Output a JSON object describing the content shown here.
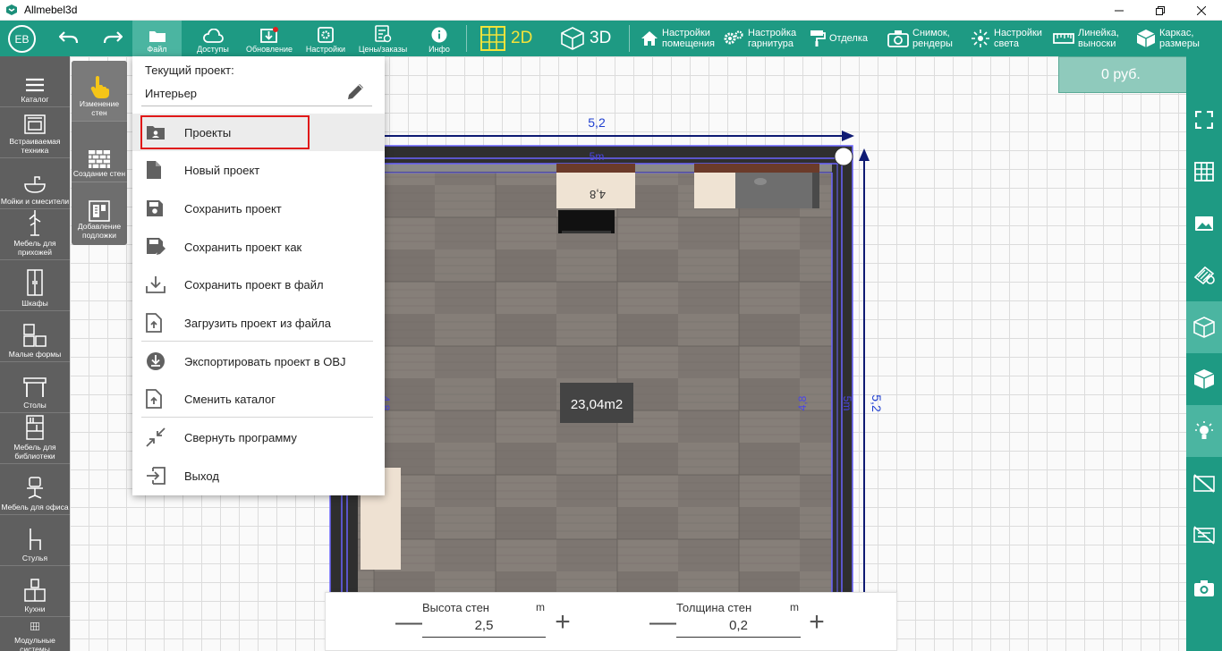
{
  "window": {
    "title": "Allmebel3d",
    "controls": [
      "minimize",
      "restore",
      "close"
    ]
  },
  "toolbar": {
    "avatar": "EB",
    "buttons": [
      {
        "id": "file",
        "label": "Файл",
        "icon": "folder-icon",
        "active": true
      },
      {
        "id": "access",
        "label": "Доступы",
        "icon": "cloud-icon"
      },
      {
        "id": "update",
        "label": "Обновление",
        "icon": "download-icon",
        "badge": true
      },
      {
        "id": "settings",
        "label": "Настройки",
        "icon": "gear-icon"
      },
      {
        "id": "prices",
        "label": "Цены/заказы",
        "icon": "price-list-icon"
      },
      {
        "id": "info",
        "label": "Инфо",
        "icon": "info-icon"
      }
    ],
    "mode_2d": "2D",
    "mode_3d": "3D",
    "tools": [
      {
        "id": "room_settings",
        "label1": "Настройки",
        "label2": "помещения",
        "icon": "home-icon"
      },
      {
        "id": "set_settings",
        "label1": "Настройка",
        "label2": "гарнитура",
        "icon": "gears-icon"
      },
      {
        "id": "finish",
        "label1": "Отделка",
        "label2": "",
        "icon": "paint-roller-icon"
      },
      {
        "id": "snapshot",
        "label1": "Снимок,",
        "label2": "рендеры",
        "icon": "camera-icon"
      },
      {
        "id": "light",
        "label1": "Настройки",
        "label2": "света",
        "icon": "light-icon"
      },
      {
        "id": "ruler",
        "label1": "Линейка,",
        "label2": "выноски",
        "icon": "ruler-icon"
      },
      {
        "id": "frame",
        "label1": "Каркас,",
        "label2": "размеры",
        "icon": "box-icon"
      }
    ]
  },
  "sidebar": {
    "categories": [
      {
        "label": "Каталог",
        "icon": "menu-icon"
      },
      {
        "label": "Встраиваемая техника",
        "icon": "oven-icon"
      },
      {
        "label": "Мойки и смесители",
        "icon": "sink-icon"
      },
      {
        "label": "Мебель для прихожей",
        "icon": "hanger-icon"
      },
      {
        "label": "Шкафы",
        "icon": "wardrobe-icon"
      },
      {
        "label": "Малые формы",
        "icon": "cabinet-icon"
      },
      {
        "label": "Столы",
        "icon": "table-icon"
      },
      {
        "label": "Мебель для библиотеки",
        "icon": "bookshelf-icon"
      },
      {
        "label": "Мебель для офиса",
        "icon": "office-chair-icon"
      },
      {
        "label": "Стулья",
        "icon": "chair-icon"
      },
      {
        "label": "Кухни",
        "icon": "kitchen-icon"
      },
      {
        "label": "Модульные системы",
        "icon": "modules-icon"
      }
    ],
    "tools": [
      {
        "label": "Изменение стен",
        "icon": "hand-pointer-icon",
        "active": true
      },
      {
        "label": "Создание стен",
        "icon": "brick-wall-icon"
      },
      {
        "label": "Добавление подложки",
        "icon": "underlay-icon"
      }
    ]
  },
  "price": {
    "value": "0 руб.",
    "icon": "cart-icon"
  },
  "menu": {
    "current_project_label": "Текущий проект:",
    "project_name": "Интерьер",
    "items": [
      {
        "label": "Проекты",
        "icon": "projects-folder-icon"
      },
      {
        "label": "Новый проект",
        "icon": "new-file-icon"
      },
      {
        "label": "Сохранить проект",
        "icon": "save-icon"
      },
      {
        "label": "Сохранить проект как",
        "icon": "save-as-icon"
      },
      {
        "label": "Сохранить проект в файл",
        "icon": "download-to-file-icon"
      },
      {
        "label": "Загрузить проект из файла",
        "icon": "upload-file-icon"
      },
      {
        "label": "Экспортировать проект в OBJ",
        "icon": "export-icon"
      },
      {
        "label": "Сменить каталог",
        "icon": "change-catalog-icon"
      },
      {
        "label": "Свернуть программу",
        "icon": "minimize-app-icon"
      },
      {
        "label": "Выход",
        "icon": "exit-icon"
      }
    ]
  },
  "plan": {
    "dim_top_outer": "5,2",
    "dim_top_inner": "5m",
    "dim_right_outer": "5,2",
    "dim_right_inner": "5m",
    "dim_right_wall": "4,8",
    "dim_top_wall": "4,8",
    "dim_left_wall": "4,8",
    "area": "23,04m2"
  },
  "bottom": {
    "height_label": "Высота стен",
    "height_unit": "m",
    "height_value": "2,5",
    "thickness_label": "Толщина стен",
    "thickness_unit": "m",
    "thickness_value": "0,2",
    "minus": "—",
    "plus": "+"
  }
}
